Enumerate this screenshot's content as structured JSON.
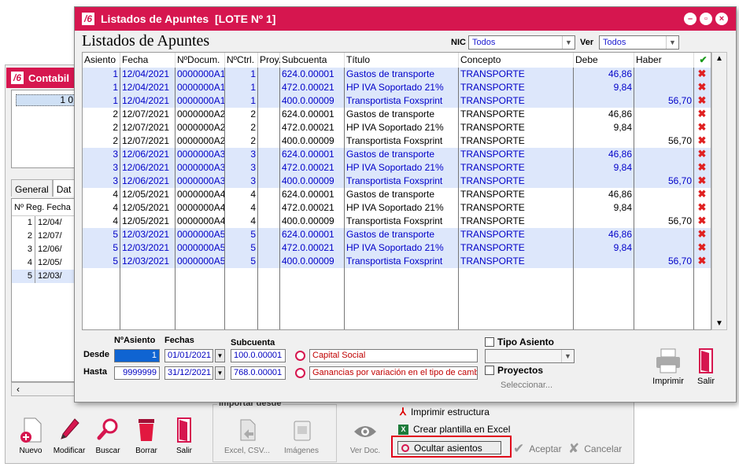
{
  "back_window": {
    "title": "Contabil",
    "list_value": "1 0",
    "tabs": [
      "General",
      "Dat"
    ],
    "grid_header": "Nº Reg. Fecha",
    "rows": [
      {
        "n": "1",
        "f": "12/04/"
      },
      {
        "n": "2",
        "f": "12/07/"
      },
      {
        "n": "3",
        "f": "12/06/"
      },
      {
        "n": "4",
        "f": "12/05/"
      },
      {
        "n": "5",
        "f": "12/03/"
      }
    ],
    "scroll_left": "‹"
  },
  "toolbar": {
    "nuevo": "Nuevo",
    "modificar": "Modificar",
    "buscar": "Buscar",
    "borrar": "Borrar",
    "salir": "Salir",
    "importar_label": "Importar desde",
    "excel_csv": "Excel, CSV...",
    "imagenes": "Imágenes",
    "ver_doc": "Ver Doc.",
    "imprimir_estructura": "Imprimir estructura",
    "crear_plantilla": "Crear plantilla en Excel",
    "ocultar_asientos": "Ocultar asientos",
    "aceptar": "Aceptar",
    "cancelar": "Cancelar"
  },
  "main_window": {
    "title": "Listados de Apuntes  [LOTE Nº 1]",
    "heading": "Listados de Apuntes",
    "nic_label": "NIC",
    "nic_value": "Todos",
    "ver_label": "Ver",
    "ver_value": "Todos"
  },
  "grid": {
    "headers": [
      "Asiento",
      "Fecha",
      "NºDocum.",
      "NºCtrl.",
      "Proy.",
      "Subcuenta",
      "Título",
      "Concepto",
      "Debe",
      "Haber"
    ],
    "check_icon": "check-icon",
    "rows": [
      {
        "asiento": "1",
        "fecha": "12/04/2021",
        "doc": "0000000A1",
        "ctrl": "1",
        "proy": "",
        "sub": "624.0.00001",
        "titulo": "Gastos de transporte",
        "concepto": "TRANSPORTE",
        "debe": "46,86",
        "haber": "",
        "blue": true
      },
      {
        "asiento": "1",
        "fecha": "12/04/2021",
        "doc": "0000000A1",
        "ctrl": "1",
        "proy": "",
        "sub": "472.0.00021",
        "titulo": "HP IVA Soportado 21%",
        "concepto": "TRANSPORTE",
        "debe": "9,84",
        "haber": "",
        "blue": true
      },
      {
        "asiento": "1",
        "fecha": "12/04/2021",
        "doc": "0000000A1",
        "ctrl": "1",
        "proy": "",
        "sub": "400.0.00009",
        "titulo": "Transportista Foxsprint",
        "concepto": "TRANSPORTE",
        "debe": "",
        "haber": "56,70",
        "blue": true
      },
      {
        "asiento": "2",
        "fecha": "12/07/2021",
        "doc": "0000000A2",
        "ctrl": "2",
        "proy": "",
        "sub": "624.0.00001",
        "titulo": "Gastos de transporte",
        "concepto": "TRANSPORTE",
        "debe": "46,86",
        "haber": "",
        "blue": false
      },
      {
        "asiento": "2",
        "fecha": "12/07/2021",
        "doc": "0000000A2",
        "ctrl": "2",
        "proy": "",
        "sub": "472.0.00021",
        "titulo": "HP IVA Soportado 21%",
        "concepto": "TRANSPORTE",
        "debe": "9,84",
        "haber": "",
        "blue": false
      },
      {
        "asiento": "2",
        "fecha": "12/07/2021",
        "doc": "0000000A2",
        "ctrl": "2",
        "proy": "",
        "sub": "400.0.00009",
        "titulo": "Transportista Foxsprint",
        "concepto": "TRANSPORTE",
        "debe": "",
        "haber": "56,70",
        "blue": false
      },
      {
        "asiento": "3",
        "fecha": "12/06/2021",
        "doc": "0000000A3",
        "ctrl": "3",
        "proy": "",
        "sub": "624.0.00001",
        "titulo": "Gastos de transporte",
        "concepto": "TRANSPORTE",
        "debe": "46,86",
        "haber": "",
        "blue": true
      },
      {
        "asiento": "3",
        "fecha": "12/06/2021",
        "doc": "0000000A3",
        "ctrl": "3",
        "proy": "",
        "sub": "472.0.00021",
        "titulo": "HP IVA Soportado 21%",
        "concepto": "TRANSPORTE",
        "debe": "9,84",
        "haber": "",
        "blue": true
      },
      {
        "asiento": "3",
        "fecha": "12/06/2021",
        "doc": "0000000A3",
        "ctrl": "3",
        "proy": "",
        "sub": "400.0.00009",
        "titulo": "Transportista Foxsprint",
        "concepto": "TRANSPORTE",
        "debe": "",
        "haber": "56,70",
        "blue": true
      },
      {
        "asiento": "4",
        "fecha": "12/05/2021",
        "doc": "0000000A4",
        "ctrl": "4",
        "proy": "",
        "sub": "624.0.00001",
        "titulo": "Gastos de transporte",
        "concepto": "TRANSPORTE",
        "debe": "46,86",
        "haber": "",
        "blue": false
      },
      {
        "asiento": "4",
        "fecha": "12/05/2021",
        "doc": "0000000A4",
        "ctrl": "4",
        "proy": "",
        "sub": "472.0.00021",
        "titulo": "HP IVA Soportado 21%",
        "concepto": "TRANSPORTE",
        "debe": "9,84",
        "haber": "",
        "blue": false
      },
      {
        "asiento": "4",
        "fecha": "12/05/2021",
        "doc": "0000000A4",
        "ctrl": "4",
        "proy": "",
        "sub": "400.0.00009",
        "titulo": "Transportista Foxsprint",
        "concepto": "TRANSPORTE",
        "debe": "",
        "haber": "56,70",
        "blue": false
      },
      {
        "asiento": "5",
        "fecha": "12/03/2021",
        "doc": "0000000A5",
        "ctrl": "5",
        "proy": "",
        "sub": "624.0.00001",
        "titulo": "Gastos de transporte",
        "concepto": "TRANSPORTE",
        "debe": "46,86",
        "haber": "",
        "blue": true
      },
      {
        "asiento": "5",
        "fecha": "12/03/2021",
        "doc": "0000000A5",
        "ctrl": "5",
        "proy": "",
        "sub": "472.0.00021",
        "titulo": "HP IVA Soportado 21%",
        "concepto": "TRANSPORTE",
        "debe": "9,84",
        "haber": "",
        "blue": true
      },
      {
        "asiento": "5",
        "fecha": "12/03/2021",
        "doc": "0000000A5",
        "ctrl": "5",
        "proy": "",
        "sub": "400.0.00009",
        "titulo": "Transportista Foxsprint",
        "concepto": "TRANSPORTE",
        "debe": "",
        "haber": "56,70",
        "blue": true
      }
    ]
  },
  "filters": {
    "asiento_label": "NºAsiento",
    "fechas_label": "Fechas",
    "subcuenta_label": "Subcuenta",
    "desde_label": "Desde",
    "hasta_label": "Hasta",
    "desde_asiento": "1",
    "hasta_asiento": "9999999",
    "desde_fecha": "01/01/2021",
    "hasta_fecha": "31/12/2021",
    "desde_sub": "100.0.00001",
    "hasta_sub": "768.0.00001",
    "desde_sub_name": "Capital Social",
    "hasta_sub_name": "Ganancias por variación en el tipo de camb",
    "tipo_asiento_label": "Tipo Asiento",
    "proyectos_label": "Proyectos",
    "seleccionar": "Seleccionar...",
    "imprimir": "Imprimir",
    "salir": "Salir"
  },
  "colors": {
    "accent": "#d6164f",
    "row_blue": "#dde7fb",
    "text_blue": "#0000c8",
    "delete_red": "#e02020",
    "highlight": "#e0001a"
  }
}
